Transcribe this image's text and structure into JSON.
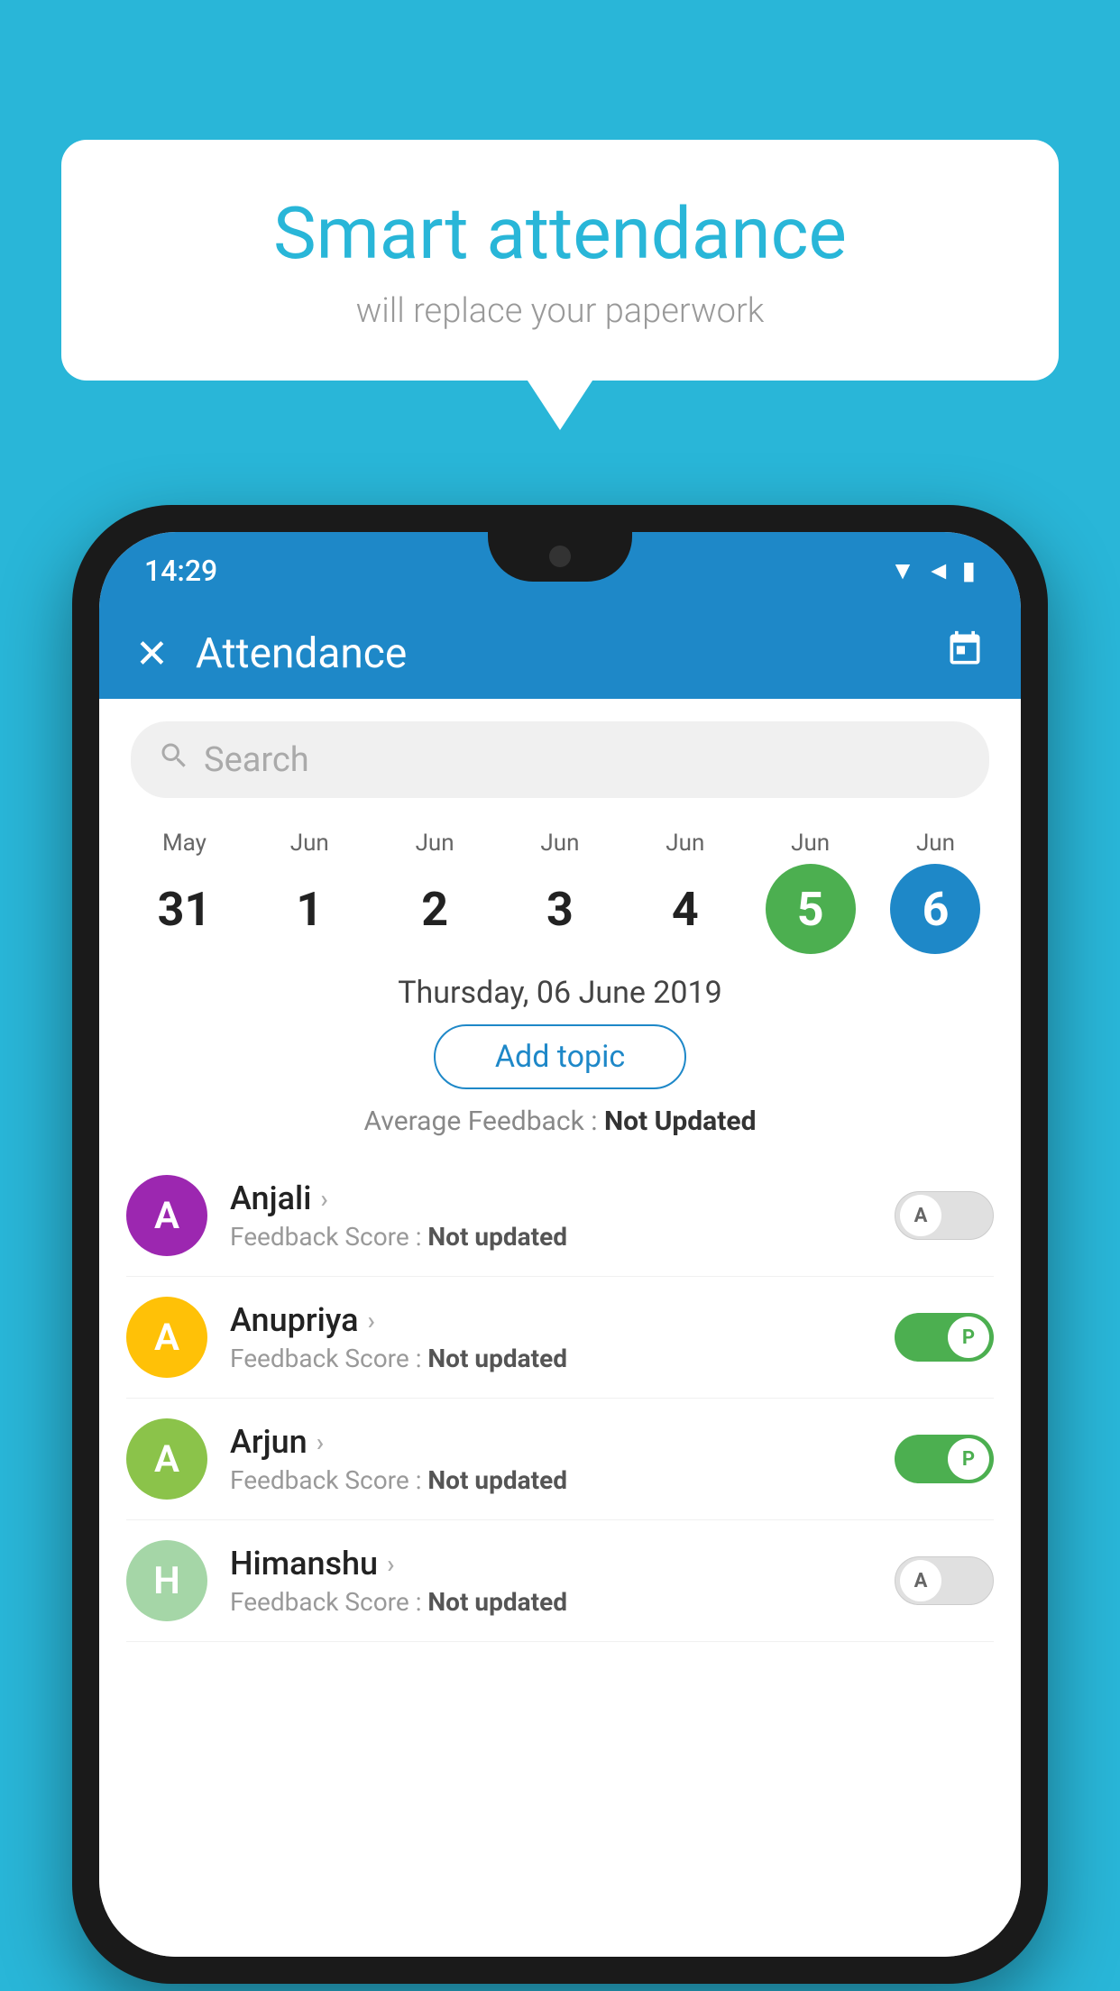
{
  "background_color": "#29b6d8",
  "speech_bubble": {
    "title": "Smart attendance",
    "subtitle": "will replace your paperwork"
  },
  "status_bar": {
    "time": "14:29",
    "signal_icon": "▼◄",
    "battery_icon": "🔋"
  },
  "header": {
    "close_label": "✕",
    "title": "Attendance",
    "calendar_icon": "📅"
  },
  "search": {
    "placeholder": "Search"
  },
  "calendar": {
    "days": [
      {
        "month": "May",
        "number": "31",
        "state": "normal"
      },
      {
        "month": "Jun",
        "number": "1",
        "state": "normal"
      },
      {
        "month": "Jun",
        "number": "2",
        "state": "normal"
      },
      {
        "month": "Jun",
        "number": "3",
        "state": "normal"
      },
      {
        "month": "Jun",
        "number": "4",
        "state": "normal"
      },
      {
        "month": "Jun",
        "number": "5",
        "state": "today"
      },
      {
        "month": "Jun",
        "number": "6",
        "state": "selected"
      }
    ]
  },
  "selected_date": "Thursday, 06 June 2019",
  "add_topic_label": "Add topic",
  "avg_feedback_label": "Average Feedback : ",
  "avg_feedback_value": "Not Updated",
  "students": [
    {
      "name": "Anjali",
      "avatar_letter": "A",
      "avatar_color": "#9c27b0",
      "score_label": "Feedback Score : ",
      "score_value": "Not updated",
      "toggle": "off",
      "toggle_letter": "A"
    },
    {
      "name": "Anupriya",
      "avatar_letter": "A",
      "avatar_color": "#ffc107",
      "score_label": "Feedback Score : ",
      "score_value": "Not updated",
      "toggle": "on",
      "toggle_letter": "P"
    },
    {
      "name": "Arjun",
      "avatar_letter": "A",
      "avatar_color": "#8bc34a",
      "score_label": "Feedback Score : ",
      "score_value": "Not updated",
      "toggle": "on",
      "toggle_letter": "P"
    },
    {
      "name": "Himanshu",
      "avatar_letter": "H",
      "avatar_color": "#a5d6a7",
      "score_label": "Feedback Score : ",
      "score_value": "Not updated",
      "toggle": "off",
      "toggle_letter": "A"
    }
  ]
}
